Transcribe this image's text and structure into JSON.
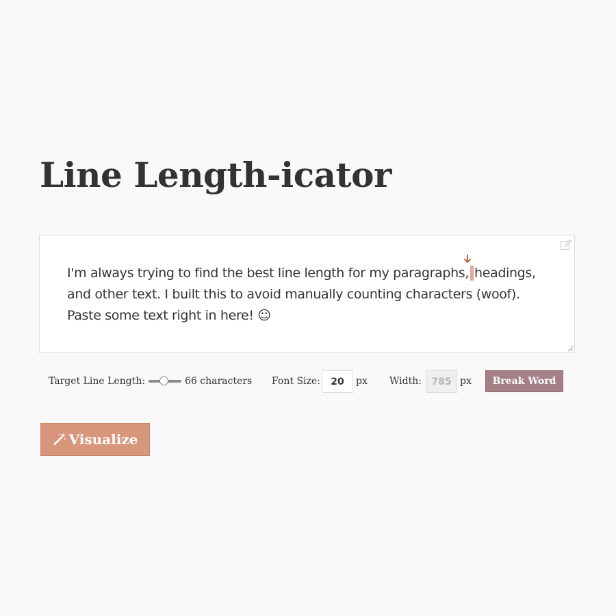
{
  "page": {
    "title": "Line Length-icator"
  },
  "editor": {
    "lines": [
      [
        "I'm always trying to find the best line length for my paragraphs,",
        "headings,"
      ],
      [
        "and other text. I built this to avoid manually counting characters (woof)."
      ],
      [
        "Paste some text right in here! ☺"
      ]
    ],
    "icons": {
      "edit": "edit-pencil-icon",
      "marker": "line-break-marker-arrow-icon",
      "resize": "resize-grip-icon"
    }
  },
  "controls": {
    "target_label": "Target Line Length:",
    "target_value_fraction": 0.45,
    "target_value_text": "66 characters",
    "font_size_label": "Font Size:",
    "font_size_value": "20",
    "font_size_unit": "px",
    "width_label": "Width:",
    "width_value": "785",
    "width_unit": "px",
    "break_word_label": "Break Word"
  },
  "actions": {
    "visualize_label": "Visualize",
    "visualize_icon": "magic-wand-icon"
  },
  "colors": {
    "background": "#f9f9f9",
    "accent": "#d8977d",
    "marker": "#c0573b",
    "marker_bar": "#e0a897",
    "break_word": "#a47f86"
  }
}
